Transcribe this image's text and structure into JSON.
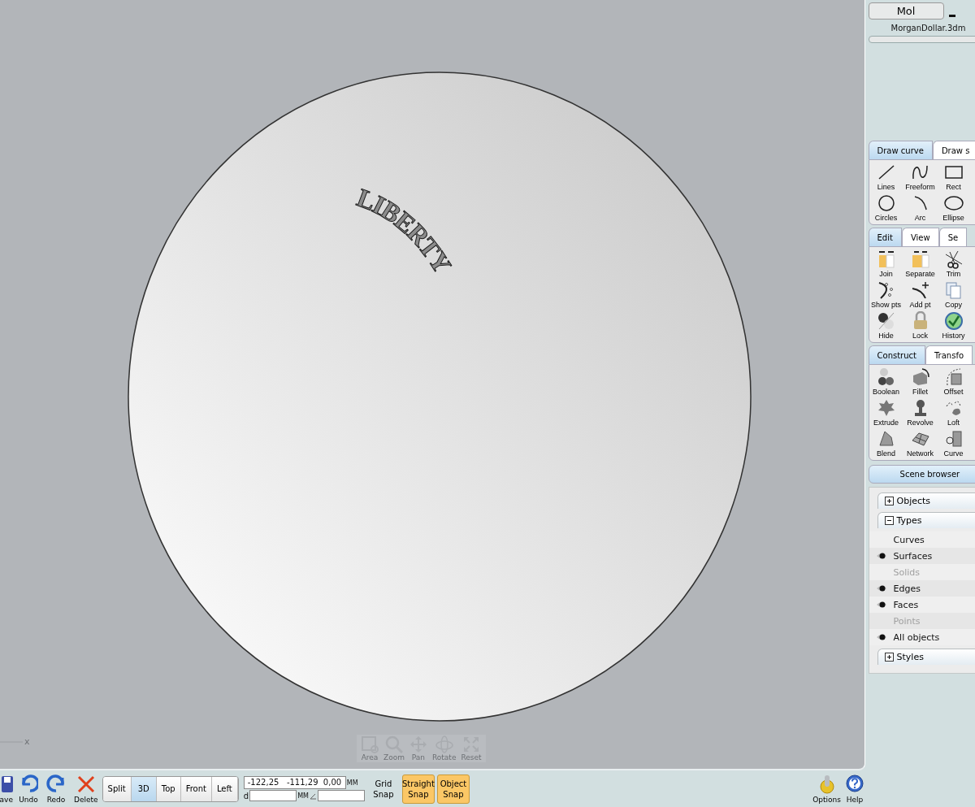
{
  "viewport": {
    "engraving": "LIBERTY",
    "axis_label": "x",
    "nav": [
      {
        "label": "Area"
      },
      {
        "label": "Zoom"
      },
      {
        "label": "Pan"
      },
      {
        "label": "Rotate"
      },
      {
        "label": "Reset"
      }
    ]
  },
  "header": {
    "app_button": "Mol",
    "filename": "MorganDollar.3dm"
  },
  "palettes": [
    {
      "tabs": [
        {
          "label": "Draw curve",
          "selected": true
        },
        {
          "label": "Draw s",
          "selected": false
        }
      ],
      "tools": [
        {
          "label": "Lines"
        },
        {
          "label": "Freeform"
        },
        {
          "label": "Rect"
        },
        {
          "label": "Circles"
        },
        {
          "label": "Arc"
        },
        {
          "label": "Ellipse"
        }
      ]
    },
    {
      "tabs": [
        {
          "label": "Edit",
          "selected": true
        },
        {
          "label": "View",
          "selected": false
        },
        {
          "label": "Se",
          "selected": false
        }
      ],
      "tools": [
        {
          "label": "Join"
        },
        {
          "label": "Separate"
        },
        {
          "label": "Trim"
        },
        {
          "label": "Show pts"
        },
        {
          "label": "Add pt"
        },
        {
          "label": "Copy"
        },
        {
          "label": "Hide"
        },
        {
          "label": "Lock"
        },
        {
          "label": "History"
        }
      ]
    },
    {
      "tabs": [
        {
          "label": "Construct",
          "selected": true
        },
        {
          "label": "Transfo",
          "selected": false
        }
      ],
      "tools": [
        {
          "label": "Boolean"
        },
        {
          "label": "Fillet"
        },
        {
          "label": "Offset"
        },
        {
          "label": "Extrude"
        },
        {
          "label": "Revolve"
        },
        {
          "label": "Loft"
        },
        {
          "label": "Blend"
        },
        {
          "label": "Network"
        },
        {
          "label": "Curve"
        }
      ]
    }
  ],
  "scene_browser": {
    "title": "Scene browser",
    "sections": [
      {
        "label": "Objects",
        "expanded": false
      },
      {
        "label": "Types",
        "expanded": true,
        "items": [
          {
            "label": "Curves",
            "visible": false,
            "disabled": false
          },
          {
            "label": "Surfaces",
            "visible": true,
            "disabled": false
          },
          {
            "label": "Solids",
            "visible": false,
            "disabled": true
          },
          {
            "label": "Edges",
            "visible": true,
            "disabled": false
          },
          {
            "label": "Faces",
            "visible": true,
            "disabled": false
          },
          {
            "label": "Points",
            "visible": false,
            "disabled": true
          },
          {
            "label": "All objects",
            "visible": true,
            "disabled": false
          }
        ]
      },
      {
        "label": "Styles",
        "expanded": false
      }
    ]
  },
  "bottom_bar": {
    "file_buttons": [
      {
        "label": "ave"
      },
      {
        "label": "Undo"
      },
      {
        "label": "Redo"
      },
      {
        "label": "Delete"
      }
    ],
    "views": [
      {
        "label": "Split",
        "selected": false
      },
      {
        "label": "3D",
        "selected": true
      },
      {
        "label": "Top",
        "selected": false
      },
      {
        "label": "Front",
        "selected": false
      },
      {
        "label": "Left",
        "selected": false
      }
    ],
    "coordinates": "-122,25   -111,29  0,00",
    "units": "MM",
    "distance_label": "d",
    "distance_units": "MM",
    "snaps": [
      {
        "line1": "Grid",
        "line2": "Snap",
        "on": false
      },
      {
        "line1": "Straight",
        "line2": "Snap",
        "on": true
      },
      {
        "line1": "Object",
        "line2": "Snap",
        "on": true
      }
    ],
    "right_buttons": [
      {
        "label": "Options"
      },
      {
        "label": "Help"
      }
    ]
  }
}
